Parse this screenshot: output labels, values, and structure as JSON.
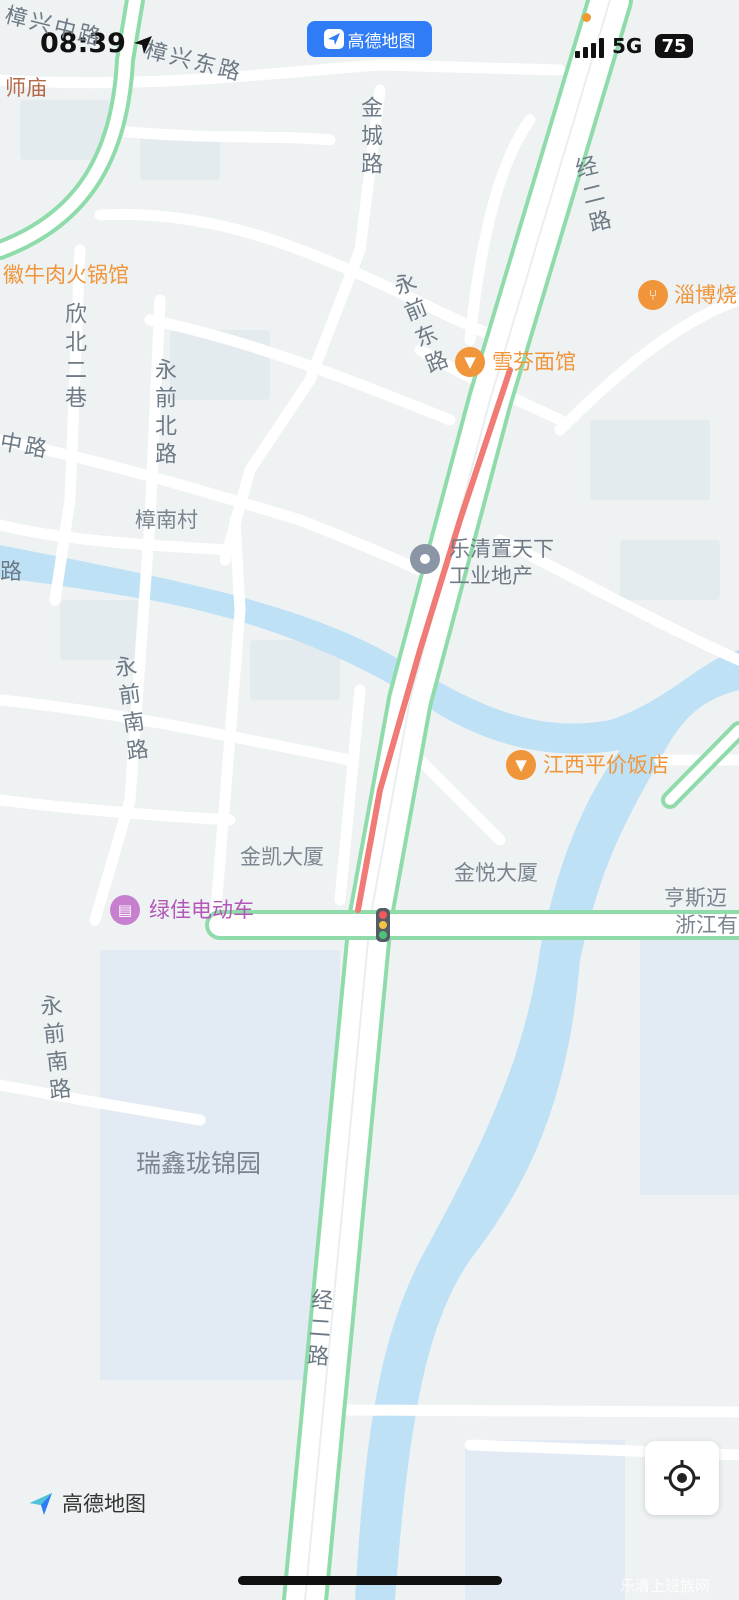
{
  "status_bar": {
    "time": "08:39",
    "app": "高德地图",
    "network": "5G",
    "battery": "75"
  },
  "map": {
    "roads": [
      "樟兴中路",
      "樟兴东路",
      "金城路",
      "经二路",
      "永前东路",
      "欣北二巷",
      "永前北路",
      "中路",
      "路",
      "永前南路",
      "永前南路",
      "经二路"
    ],
    "places": [
      "师庙",
      "樟南村",
      "金凯大厦",
      "金悦大厦",
      "瑞鑫珑锦园",
      "亨斯迈",
      "浙江有"
    ],
    "pois": [
      {
        "name": "徽牛肉火锅馆",
        "icon": "restaurant-icon"
      },
      {
        "name": "淄博烧",
        "icon": "restaurant-icon"
      },
      {
        "name": "雪芬面馆",
        "icon": "restaurant-icon"
      },
      {
        "name": "乐清置天下工业地产",
        "icon": "location-pin-icon"
      },
      {
        "name": "江西平价饭店",
        "icon": "restaurant-icon"
      },
      {
        "name": "绿佳电动车",
        "icon": "shop-icon"
      }
    ],
    "colors": {
      "background": "#eef2f3",
      "road": "#ffffff",
      "main_road_edge": "#8fdcaa",
      "congestion": "#f07a76",
      "water": "#bfe1f6",
      "poi_orange": "#f0953a",
      "poi_purple": "#b356b8"
    }
  },
  "footer": {
    "logo_text": "高德地图",
    "locate_icon": "locate-crosshair-icon",
    "watermark": "乐清上班族网"
  }
}
